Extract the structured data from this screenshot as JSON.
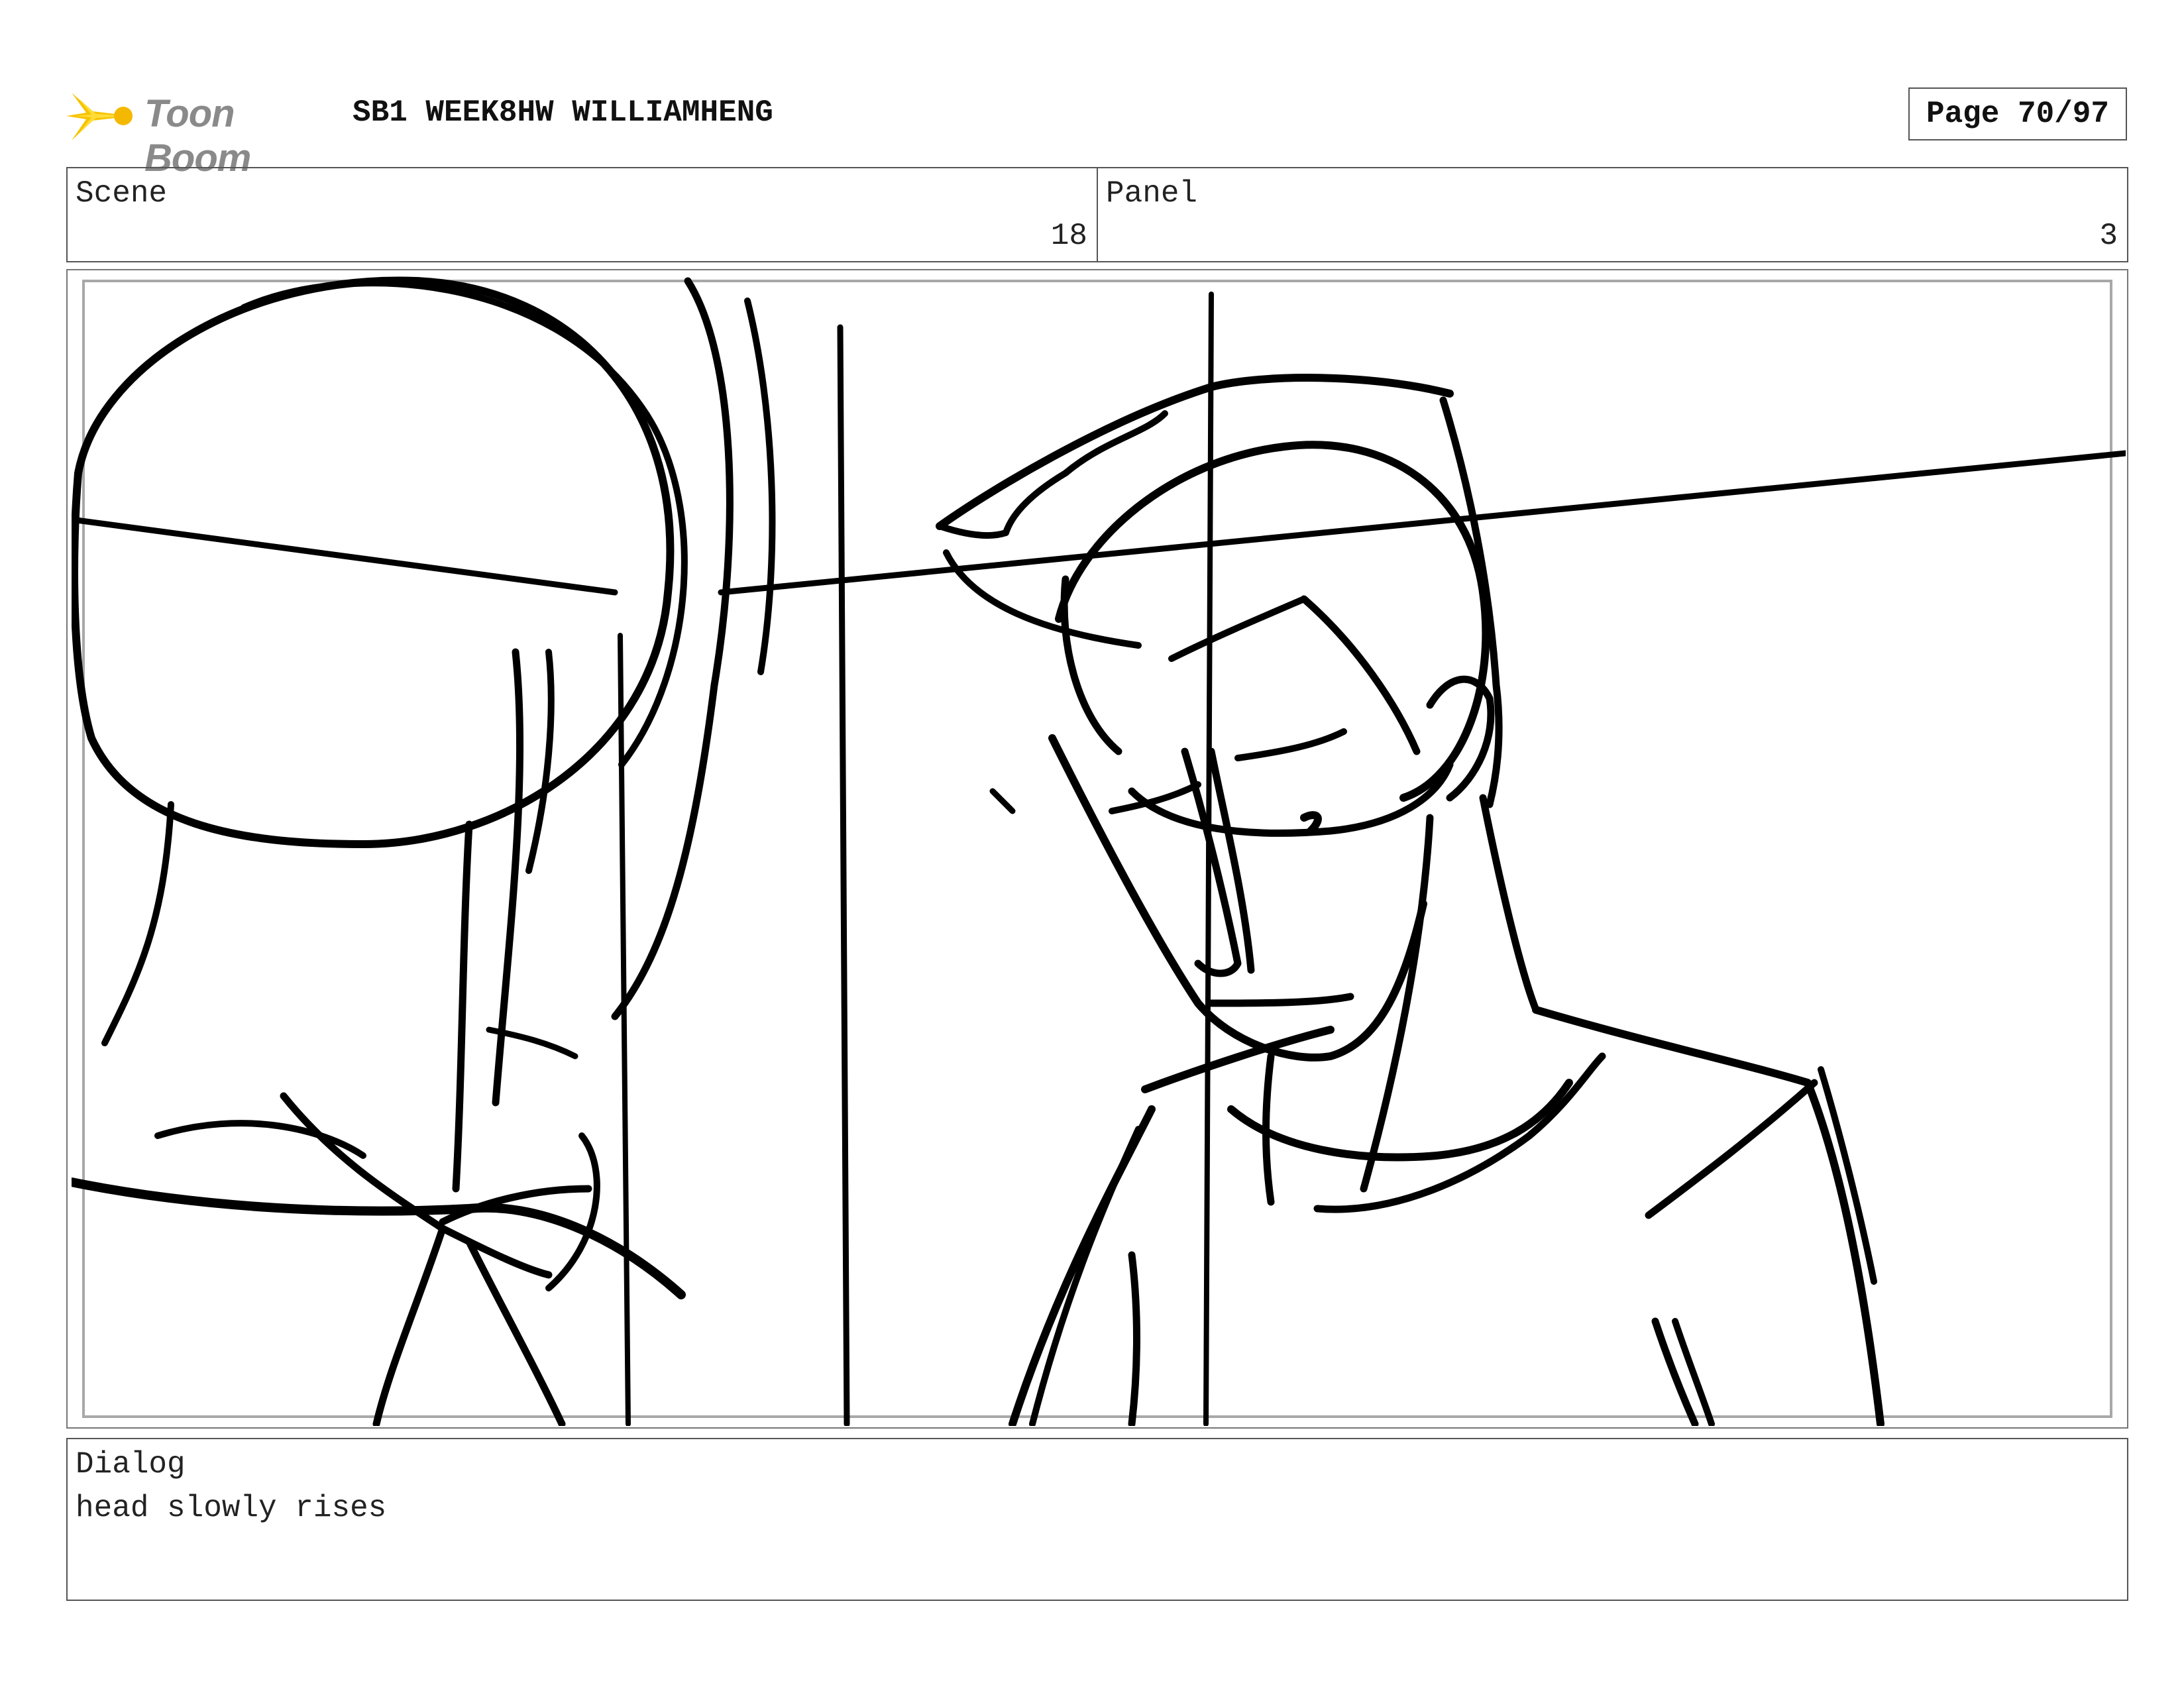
{
  "header": {
    "logo_text": "Toon Boom",
    "project_title": "SB1 WEEK8HW WILLIAMHENG",
    "page_label": "Page 70/97"
  },
  "info": {
    "scene_label": "Scene",
    "scene_value": "18",
    "panel_label": "Panel",
    "panel_value": "3"
  },
  "dialog": {
    "label": "Dialog",
    "text": "head slowly rises"
  },
  "colors": {
    "logo_yellow": "#f5c400",
    "logo_gray": "#8a8a8a",
    "border": "#555555",
    "sketch_stroke": "#000000"
  },
  "icons": {
    "logo": "toon-boom-starburst-icon"
  }
}
